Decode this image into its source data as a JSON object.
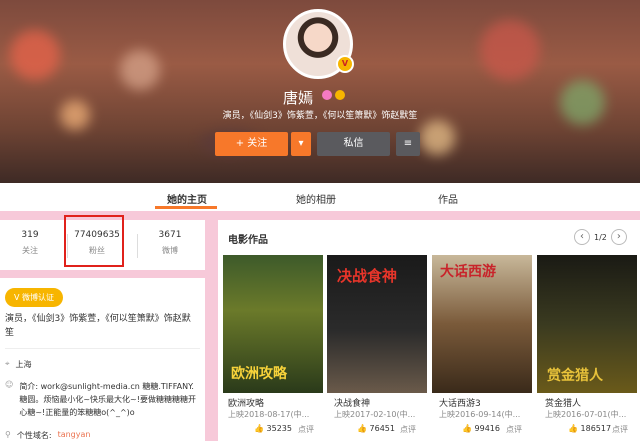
{
  "profile": {
    "name": "唐嫣",
    "bio": "演员，《仙剑3》饰紫萱，《何以笙箫默》饰赵默笙",
    "follow_label": "+ 关注",
    "message_label": "私信"
  },
  "tabs": [
    {
      "label": "她的主页"
    },
    {
      "label": "她的相册"
    },
    {
      "label": "作品"
    }
  ],
  "stats": [
    {
      "value": "319",
      "label": "关注"
    },
    {
      "value": "77409635",
      "label": "粉丝"
    },
    {
      "value": "3671",
      "label": "微博"
    }
  ],
  "info": {
    "badge": "微博认证",
    "description": "演员，《仙剑3》饰紫萱，《何以笙箫默》饰赵默笙",
    "location": "上海",
    "intro_label": "简介:",
    "intro_text": "work@sunlight-media.cn 糖糖.TIFFANY.糖圆。烦恼最小化~快乐最大化~!要做糖糖糖糖开心糖~!正能量的笨糖糖o(^_^)o",
    "domain_label": "个性域名:",
    "domain_value": "tangyan"
  },
  "movies_section": {
    "title": "电影作品",
    "page": "1/2",
    "items": [
      {
        "title": "欧洲攻略",
        "date": "上映2018-08-17(中...",
        "likes": "35235",
        "comment": "点评"
      },
      {
        "title": "决战食神",
        "date": "上映2017-02-10(中...",
        "likes": "76451",
        "comment": "点评"
      },
      {
        "title": "大话西游3",
        "date": "上映2016-09-14(中...",
        "likes": "99416",
        "comment": "点评"
      },
      {
        "title": "赏金猎人",
        "date": "上映2016-07-01(中...",
        "likes": "186517",
        "comment": "点评"
      }
    ]
  },
  "poster_text": [
    "欧洲攻略",
    "决战食神",
    "大话西游",
    "赏金猎人"
  ],
  "colors": {
    "accent": "#f7782a",
    "highlight": "#e0211b"
  }
}
